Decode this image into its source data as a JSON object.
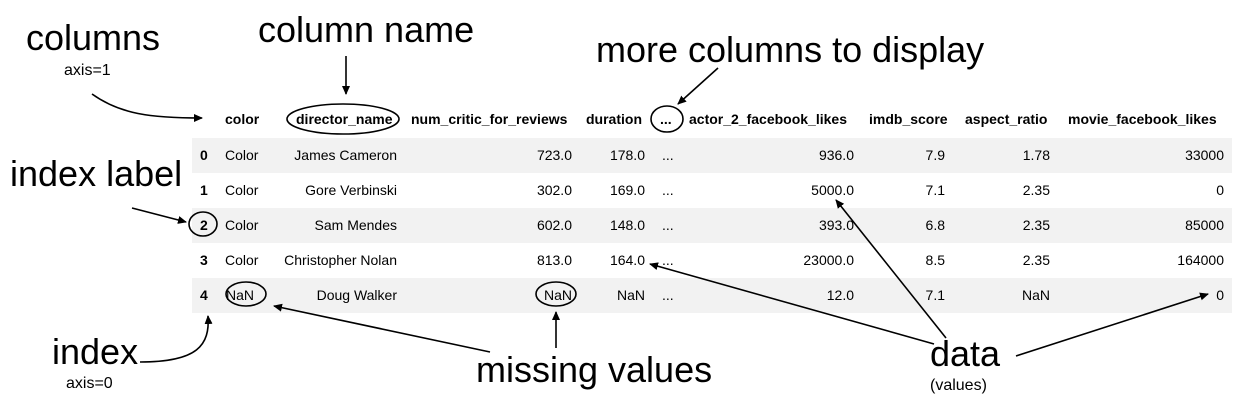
{
  "annotations": {
    "columns": "columns",
    "columns_axis": "axis=1",
    "column_name": "column name",
    "more_columns": "more columns to display",
    "index_label": "index label",
    "index": "index",
    "index_axis": "axis=0",
    "missing_values": "missing values",
    "data": "data",
    "data_sub": "(values)"
  },
  "table": {
    "columns": [
      "color",
      "director_name",
      "num_critic_for_reviews",
      "duration",
      "...",
      "actor_2_facebook_likes",
      "imdb_score",
      "aspect_ratio",
      "movie_facebook_likes"
    ],
    "rows": [
      {
        "index": "0",
        "cells": [
          "Color",
          "James Cameron",
          "723.0",
          "178.0",
          "...",
          "936.0",
          "7.9",
          "1.78",
          "33000"
        ]
      },
      {
        "index": "1",
        "cells": [
          "Color",
          "Gore Verbinski",
          "302.0",
          "169.0",
          "...",
          "5000.0",
          "7.1",
          "2.35",
          "0"
        ]
      },
      {
        "index": "2",
        "cells": [
          "Color",
          "Sam Mendes",
          "602.0",
          "148.0",
          "...",
          "393.0",
          "6.8",
          "2.35",
          "85000"
        ]
      },
      {
        "index": "3",
        "cells": [
          "Color",
          "Christopher Nolan",
          "813.0",
          "164.0",
          "...",
          "23000.0",
          "8.5",
          "2.35",
          "164000"
        ]
      },
      {
        "index": "4",
        "cells": [
          "NaN",
          "Doug Walker",
          "NaN",
          "NaN",
          "...",
          "12.0",
          "7.1",
          "NaN",
          "0"
        ]
      }
    ]
  }
}
